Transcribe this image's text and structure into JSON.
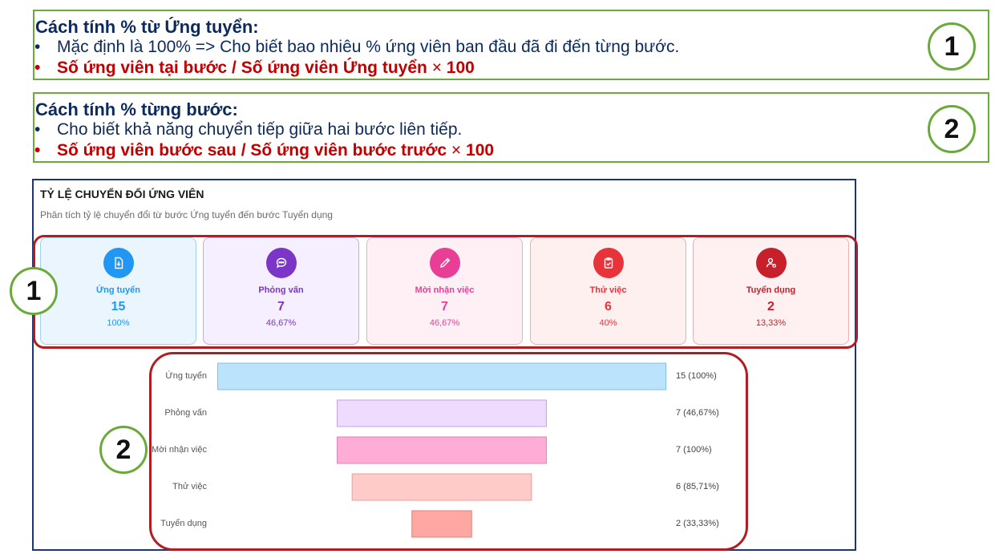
{
  "notes": [
    {
      "title": "Cách tính % từ Ứng tuyển:",
      "bullet": "•",
      "line1": "Mặc định là 100% => Cho biết bao nhiêu % ứng viên ban đầu đã đi đến từng bước.",
      "line2_formula": "Số ứng viên tại bước / Số ứng viên Ứng tuyển",
      "line2_times": " × ",
      "line2_factor": "100",
      "badge": "1"
    },
    {
      "title": "Cách tính % từng bước:",
      "bullet": "•",
      "line1": "Cho biết khả năng chuyển tiếp giữa hai bước liên tiếp.",
      "line2_formula": "Số ứng viên bước sau / Số ứng viên bước trước",
      "line2_times": " × ",
      "line2_factor": "100",
      "badge": "2"
    }
  ],
  "card": {
    "title": "TỶ LỆ CHUYỂN ĐỔI ỨNG VIÊN",
    "subtitle": "Phân tích tỷ lệ chuyển đổi từ bước Ứng tuyển đến bước Tuyển dụng"
  },
  "stages": [
    {
      "label": "Ứng tuyển",
      "count": "15",
      "percent": "100%",
      "icon": "file-download-icon",
      "color": "#2196f3",
      "bg": "#eaf5fd",
      "border": "#9fd0f3"
    },
    {
      "label": "Phỏng vấn",
      "count": "7",
      "percent": "46,67%",
      "icon": "chat-bubble-icon",
      "color": "#7b35c7",
      "bg": "#f6efff",
      "border": "#c9a8ea"
    },
    {
      "label": "Mời nhận việc",
      "count": "7",
      "percent": "46,67%",
      "icon": "pencil-icon",
      "color": "#e83e96",
      "bg": "#fff0f6",
      "border": "#f2a9cd"
    },
    {
      "label": "Thử việc",
      "count": "6",
      "percent": "40%",
      "icon": "clipboard-check-icon",
      "color": "#e8333b",
      "bg": "#fff0f0",
      "border": "#f3a9ac"
    },
    {
      "label": "Tuyển dụng",
      "count": "2",
      "percent": "13,33%",
      "icon": "user-check-icon",
      "color": "#c8202b",
      "bg": "#fff1f1",
      "border": "#eeb0b3"
    }
  ],
  "chart_data": {
    "type": "bar",
    "orientation": "horizontal-funnel",
    "categories": [
      "Ứng tuyển",
      "Phỏng vấn",
      "Mời nhận việc",
      "Thử việc",
      "Tuyển dụng"
    ],
    "values": [
      15,
      7,
      7,
      6,
      2
    ],
    "value_labels": [
      "15 (100%)",
      "7 (46,67%)",
      "7 (100%)",
      "6 (85,71%)",
      "2 (33,33%)"
    ],
    "xlim": [
      0,
      15
    ],
    "colors": {
      "fill": [
        "#bbe3fb",
        "#efdbfd",
        "#ffadd6",
        "#ffcbc8",
        "#ffa8a3"
      ],
      "stroke": [
        "#7cc3ef",
        "#c5a0ea",
        "#e37fb3",
        "#ef9c98",
        "#e4807b"
      ]
    },
    "grid": false,
    "legend": "none"
  },
  "overlay_badges": [
    "1",
    "2"
  ]
}
